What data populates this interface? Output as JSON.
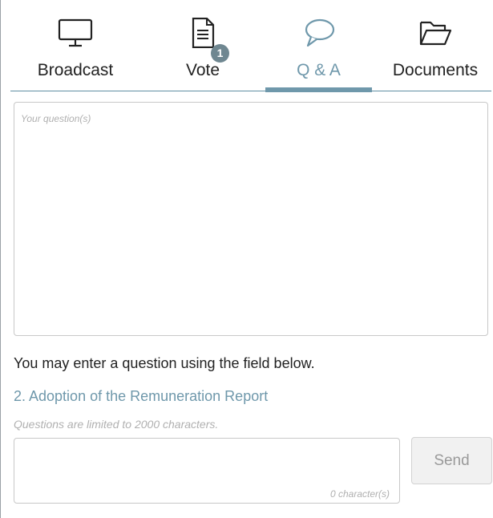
{
  "tabs": [
    {
      "label": "Broadcast",
      "icon": "monitor-icon",
      "active": false
    },
    {
      "label": "Vote",
      "icon": "document-icon",
      "active": false,
      "badge": "1"
    },
    {
      "label": "Q & A",
      "icon": "speech-bubble-icon",
      "active": true
    },
    {
      "label": "Documents",
      "icon": "folder-open-icon",
      "active": false
    }
  ],
  "colors": {
    "accent": "#6f98ab",
    "badge": "#6f8791",
    "border": "#c8c8c8"
  },
  "question_area": {
    "placeholder": "Your question(s)"
  },
  "info_text": "You may enter a question using the field below.",
  "topic": "2. Adoption of the Remuneration Report",
  "limit_text": "Questions are limited to 2000 characters.",
  "compose": {
    "char_count": "0 character(s)",
    "send_label": "Send"
  }
}
